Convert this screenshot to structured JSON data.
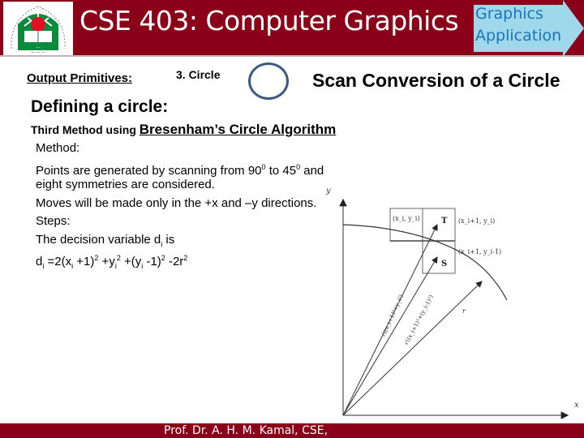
{
  "header": {
    "title": "CSE 403: Computer Graphics",
    "app_badge_line1": "Graphics",
    "app_badge_line2": "Application",
    "logo": "university-logo"
  },
  "content": {
    "section_label": "Output Primitives:",
    "topic_label": "3. Circle",
    "slide_title": "Scan Conversion of a Circle",
    "heading": "Defining a circle:",
    "method_prefix": "Third Method using ",
    "method_name": "Bresenham’s Circle Algorithm",
    "lines": {
      "method": "Method:",
      "points_a": "Points are generated by scanning from 90",
      "points_sup1": "0",
      "points_b": " to 45",
      "points_sup2": "0",
      "points_c": " and",
      "symmetry": "eight symmetries are considered.",
      "moves": "Moves will be made only in the +x and –y directions.",
      "steps": "Steps:",
      "decision_a": "The decision variable d",
      "decision_sub": "i",
      "decision_b": " is",
      "formula": "d_i = 2(x_i + 1)^2 + y_i^2 + (y_i - 1)^2 - 2r^2"
    }
  },
  "diagram": {
    "axis_x": "x",
    "axis_y": "y",
    "pixel_current": "(x_i, y_i)",
    "pixel_T_label": "T",
    "pixel_T_coord": "(x_i+1, y_i)",
    "pixel_S_label": "S",
    "pixel_S_coord": "(x_i+1, y_i-1)",
    "dist_T": "√((x_i+1)²+y_i²)",
    "dist_S": "√((x_i+1)²+(y_i-1)²)",
    "radius": "r"
  },
  "footer": {
    "author": "Prof. Dr. A. H. M. Kamal, CSE,"
  }
}
